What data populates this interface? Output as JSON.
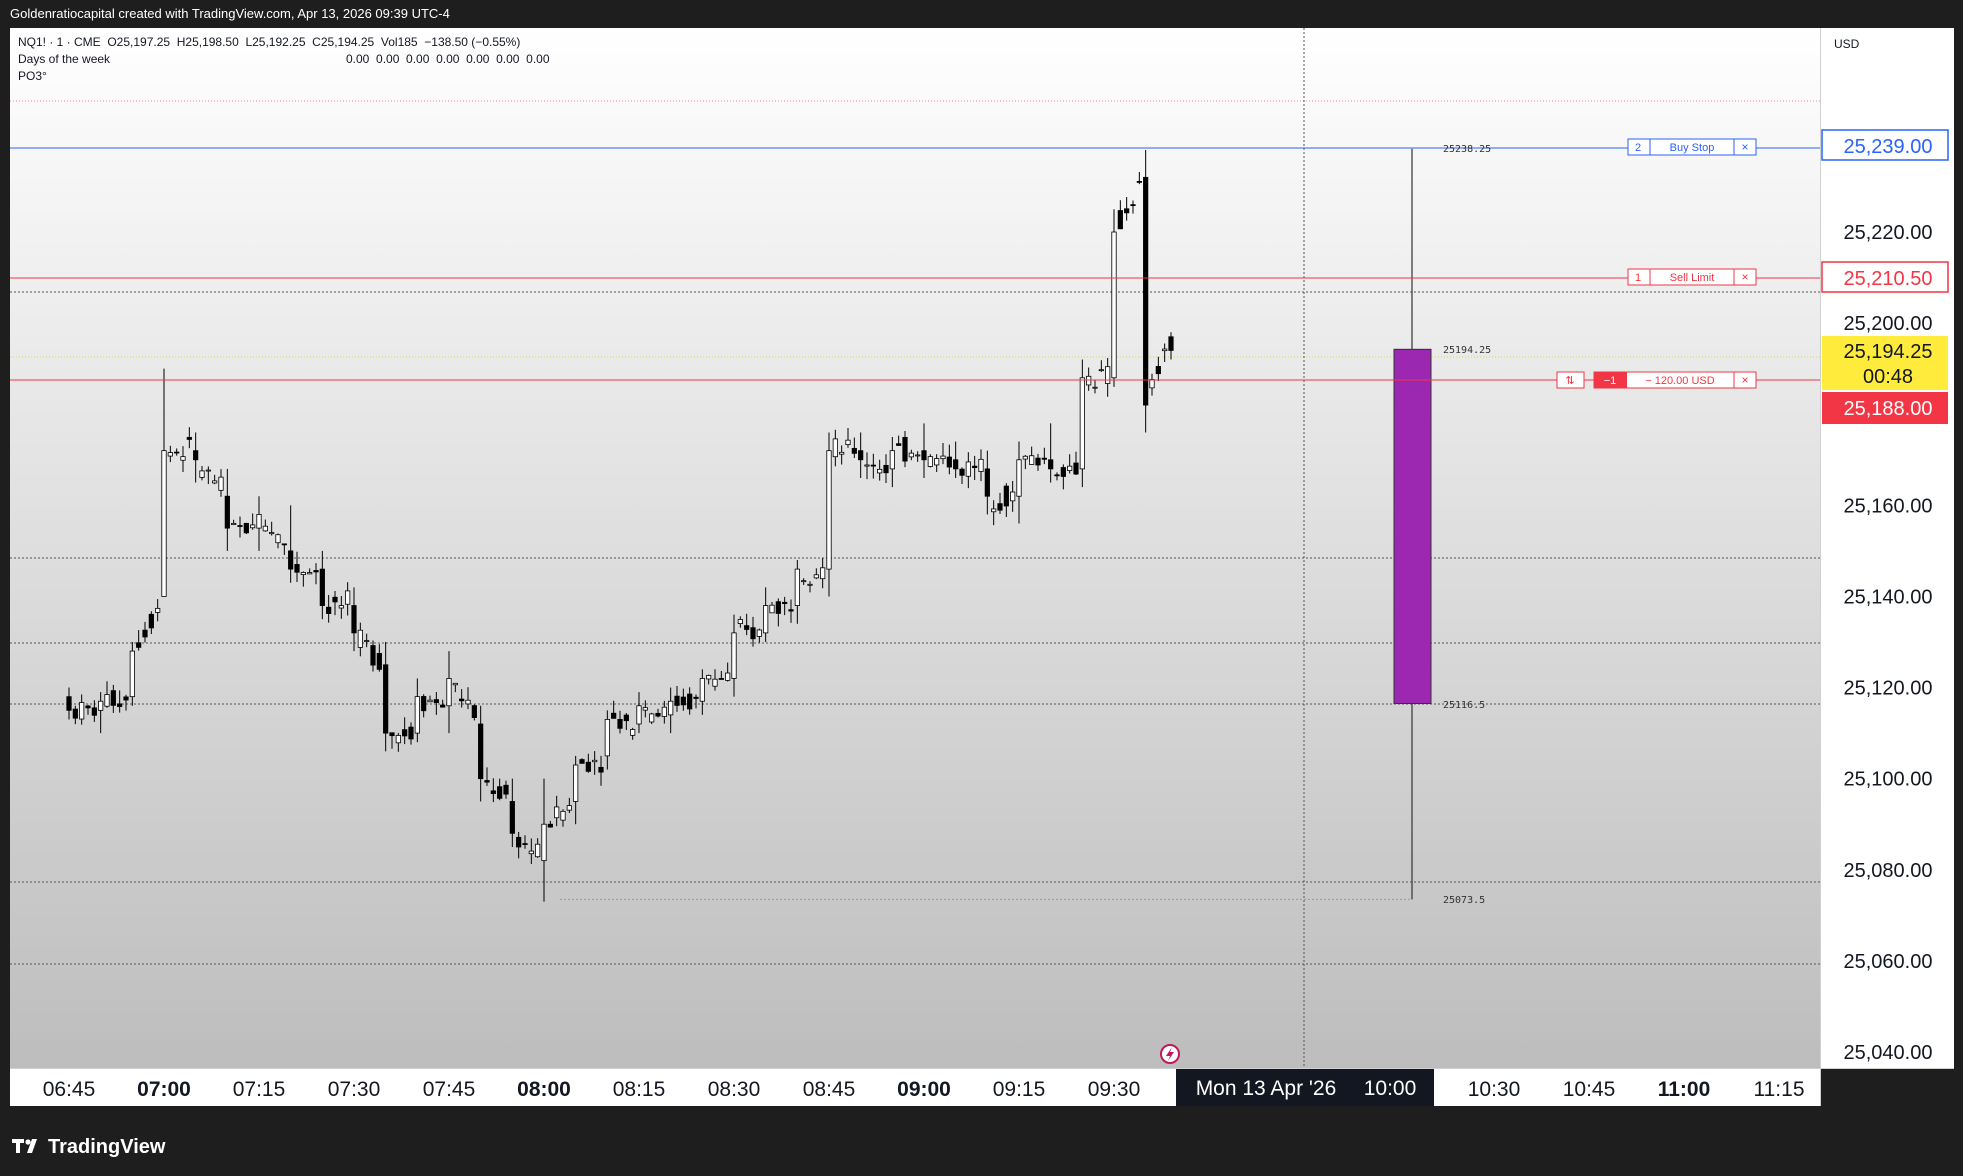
{
  "header": {
    "title": "Goldenratiocapital created with TradingView.com, Apr 13, 2026 09:39 UTC-4"
  },
  "legend": {
    "symbol_line": "NQ1! · 1 · CME  O25,197.25  H25,198.50  L25,192.25  C25,194.25  Vol185  −138.50 (−0.55%)",
    "indicator1": "Days of the week",
    "indicator1_values": "0.00  0.00  0.00  0.00  0.00  0.00  0.00",
    "indicator2": "PO3°"
  },
  "price_axis": {
    "currency": "USD",
    "ticks": [
      "25,220.00",
      "25,200.00",
      "25,160.00",
      "25,140.00",
      "25,120.00",
      "25,100.00",
      "25,080.00",
      "25,060.00",
      "25,040.00"
    ],
    "buy_stop_price": "25,239.00",
    "sell_limit_price": "25,210.50",
    "last_price": "25,194.25",
    "countdown": "00:48",
    "position_price": "25,188.00"
  },
  "time_axis": {
    "ticks": [
      "06:45",
      "07:00",
      "07:15",
      "07:30",
      "07:45",
      "08:00",
      "08:15",
      "08:30",
      "08:45",
      "09:00",
      "09:15",
      "09:30",
      "10:30",
      "10:45",
      "11:00",
      "11:15"
    ],
    "bold_ticks": [
      "07:00",
      "08:00",
      "09:00",
      "11:00"
    ],
    "crosshair_label_date": "Mon 13 Apr '26",
    "crosshair_label_time": "10:00"
  },
  "orders": {
    "buy_stop": {
      "qty": "2",
      "label": "Buy Stop",
      "close": "×"
    },
    "sell_limit": {
      "qty": "1",
      "label": "Sell Limit",
      "close": "×"
    },
    "position": {
      "reverse": "⇅",
      "qty": "−1",
      "label": "− 120.00 USD",
      "close": "×"
    }
  },
  "po3_labels": {
    "high": "25238.25",
    "open": "25194.25",
    "close": "25116.5",
    "low": "25073.5"
  },
  "footer": {
    "brand": "TradingView",
    "logo_icon": "tradingview-logo-icon"
  },
  "colors": {
    "buy_stop": "#2962ff",
    "sell": "#f23645",
    "last_price": "#ffeb3b",
    "po3_candle": "#9c27b0",
    "candle_up": "#ffffff",
    "candle_down": "#000000"
  },
  "chart_data": {
    "type": "candlestick",
    "price_range": [
      25033,
      25268
    ],
    "time_range": [
      "06:34",
      "11:26"
    ],
    "candles_approx": [
      {
        "t": "06:45",
        "o": 25118,
        "h": 25120,
        "l": 25113,
        "c": 25115
      },
      {
        "t": "06:50",
        "o": 25115,
        "h": 25119,
        "l": 25110,
        "c": 25117
      },
      {
        "t": "06:55",
        "o": 25118,
        "h": 25130,
        "l": 25116,
        "c": 25128
      },
      {
        "t": "07:00",
        "o": 25140,
        "h": 25190,
        "l": 25150,
        "c": 25172
      },
      {
        "t": "07:05",
        "o": 25172,
        "h": 25176,
        "l": 25165,
        "c": 25170
      },
      {
        "t": "07:10",
        "o": 25162,
        "h": 25168,
        "l": 25150,
        "c": 25155
      },
      {
        "t": "07:15",
        "o": 25155,
        "h": 25162,
        "l": 25150,
        "c": 25158
      },
      {
        "t": "07:20",
        "o": 25150,
        "h": 25160,
        "l": 25143,
        "c": 25146
      },
      {
        "t": "07:25",
        "o": 25146,
        "h": 25150,
        "l": 25135,
        "c": 25138
      },
      {
        "t": "07:30",
        "o": 25138,
        "h": 25142,
        "l": 25128,
        "c": 25132
      },
      {
        "t": "07:35",
        "o": 25125,
        "h": 25130,
        "l": 25106,
        "c": 25110
      },
      {
        "t": "07:40",
        "o": 25110,
        "h": 25122,
        "l": 25108,
        "c": 25118
      },
      {
        "t": "07:45",
        "o": 25116,
        "h": 25128,
        "l": 25110,
        "c": 25122
      },
      {
        "t": "07:50",
        "o": 25112,
        "h": 25116,
        "l": 25095,
        "c": 25100
      },
      {
        "t": "07:55",
        "o": 25095,
        "h": 25100,
        "l": 25085,
        "c": 25088
      },
      {
        "t": "08:00",
        "o": 25082,
        "h": 25100,
        "l": 25073,
        "c": 25090
      },
      {
        "t": "08:05",
        "o": 25095,
        "h": 25105,
        "l": 25090,
        "c": 25103
      },
      {
        "t": "08:10",
        "o": 25105,
        "h": 25115,
        "l": 25102,
        "c": 25113
      },
      {
        "t": "08:15",
        "o": 25112,
        "h": 25119,
        "l": 25110,
        "c": 25116
      },
      {
        "t": "08:20",
        "o": 25114,
        "h": 25120,
        "l": 25110,
        "c": 25117
      },
      {
        "t": "08:25",
        "o": 25117,
        "h": 25124,
        "l": 25114,
        "c": 25122
      },
      {
        "t": "08:30",
        "o": 25122,
        "h": 25136,
        "l": 25118,
        "c": 25132
      },
      {
        "t": "08:35",
        "o": 25132,
        "h": 25142,
        "l": 25130,
        "c": 25138
      },
      {
        "t": "08:40",
        "o": 25138,
        "h": 25148,
        "l": 25134,
        "c": 25146
      },
      {
        "t": "08:45",
        "o": 25146,
        "h": 25176,
        "l": 25140,
        "c": 25172
      },
      {
        "t": "08:50",
        "o": 25172,
        "h": 25176,
        "l": 25166,
        "c": 25170
      },
      {
        "t": "08:55",
        "o": 25168,
        "h": 25175,
        "l": 25164,
        "c": 25172
      },
      {
        "t": "09:00",
        "o": 25172,
        "h": 25178,
        "l": 25166,
        "c": 25170
      },
      {
        "t": "09:05",
        "o": 25170,
        "h": 25174,
        "l": 25166,
        "c": 25168
      },
      {
        "t": "09:10",
        "o": 25168,
        "h": 25172,
        "l": 25158,
        "c": 25162
      },
      {
        "t": "09:15",
        "o": 25162,
        "h": 25174,
        "l": 25156,
        "c": 25170
      },
      {
        "t": "09:20",
        "o": 25170,
        "h": 25178,
        "l": 25165,
        "c": 25168
      },
      {
        "t": "09:25",
        "o": 25168,
        "h": 25192,
        "l": 25164,
        "c": 25188
      },
      {
        "t": "09:30",
        "o": 25188,
        "h": 25225,
        "l": 25186,
        "c": 25220
      },
      {
        "t": "09:35",
        "o": 25232,
        "h": 25238,
        "l": 25176,
        "c": 25182
      },
      {
        "t": "09:39",
        "o": 25197,
        "h": 25198,
        "l": 25192,
        "c": 25194
      }
    ],
    "po3_candle": {
      "open": 25194.25,
      "high": 25238.25,
      "low": 25073.5,
      "close": 25116.5
    }
  }
}
